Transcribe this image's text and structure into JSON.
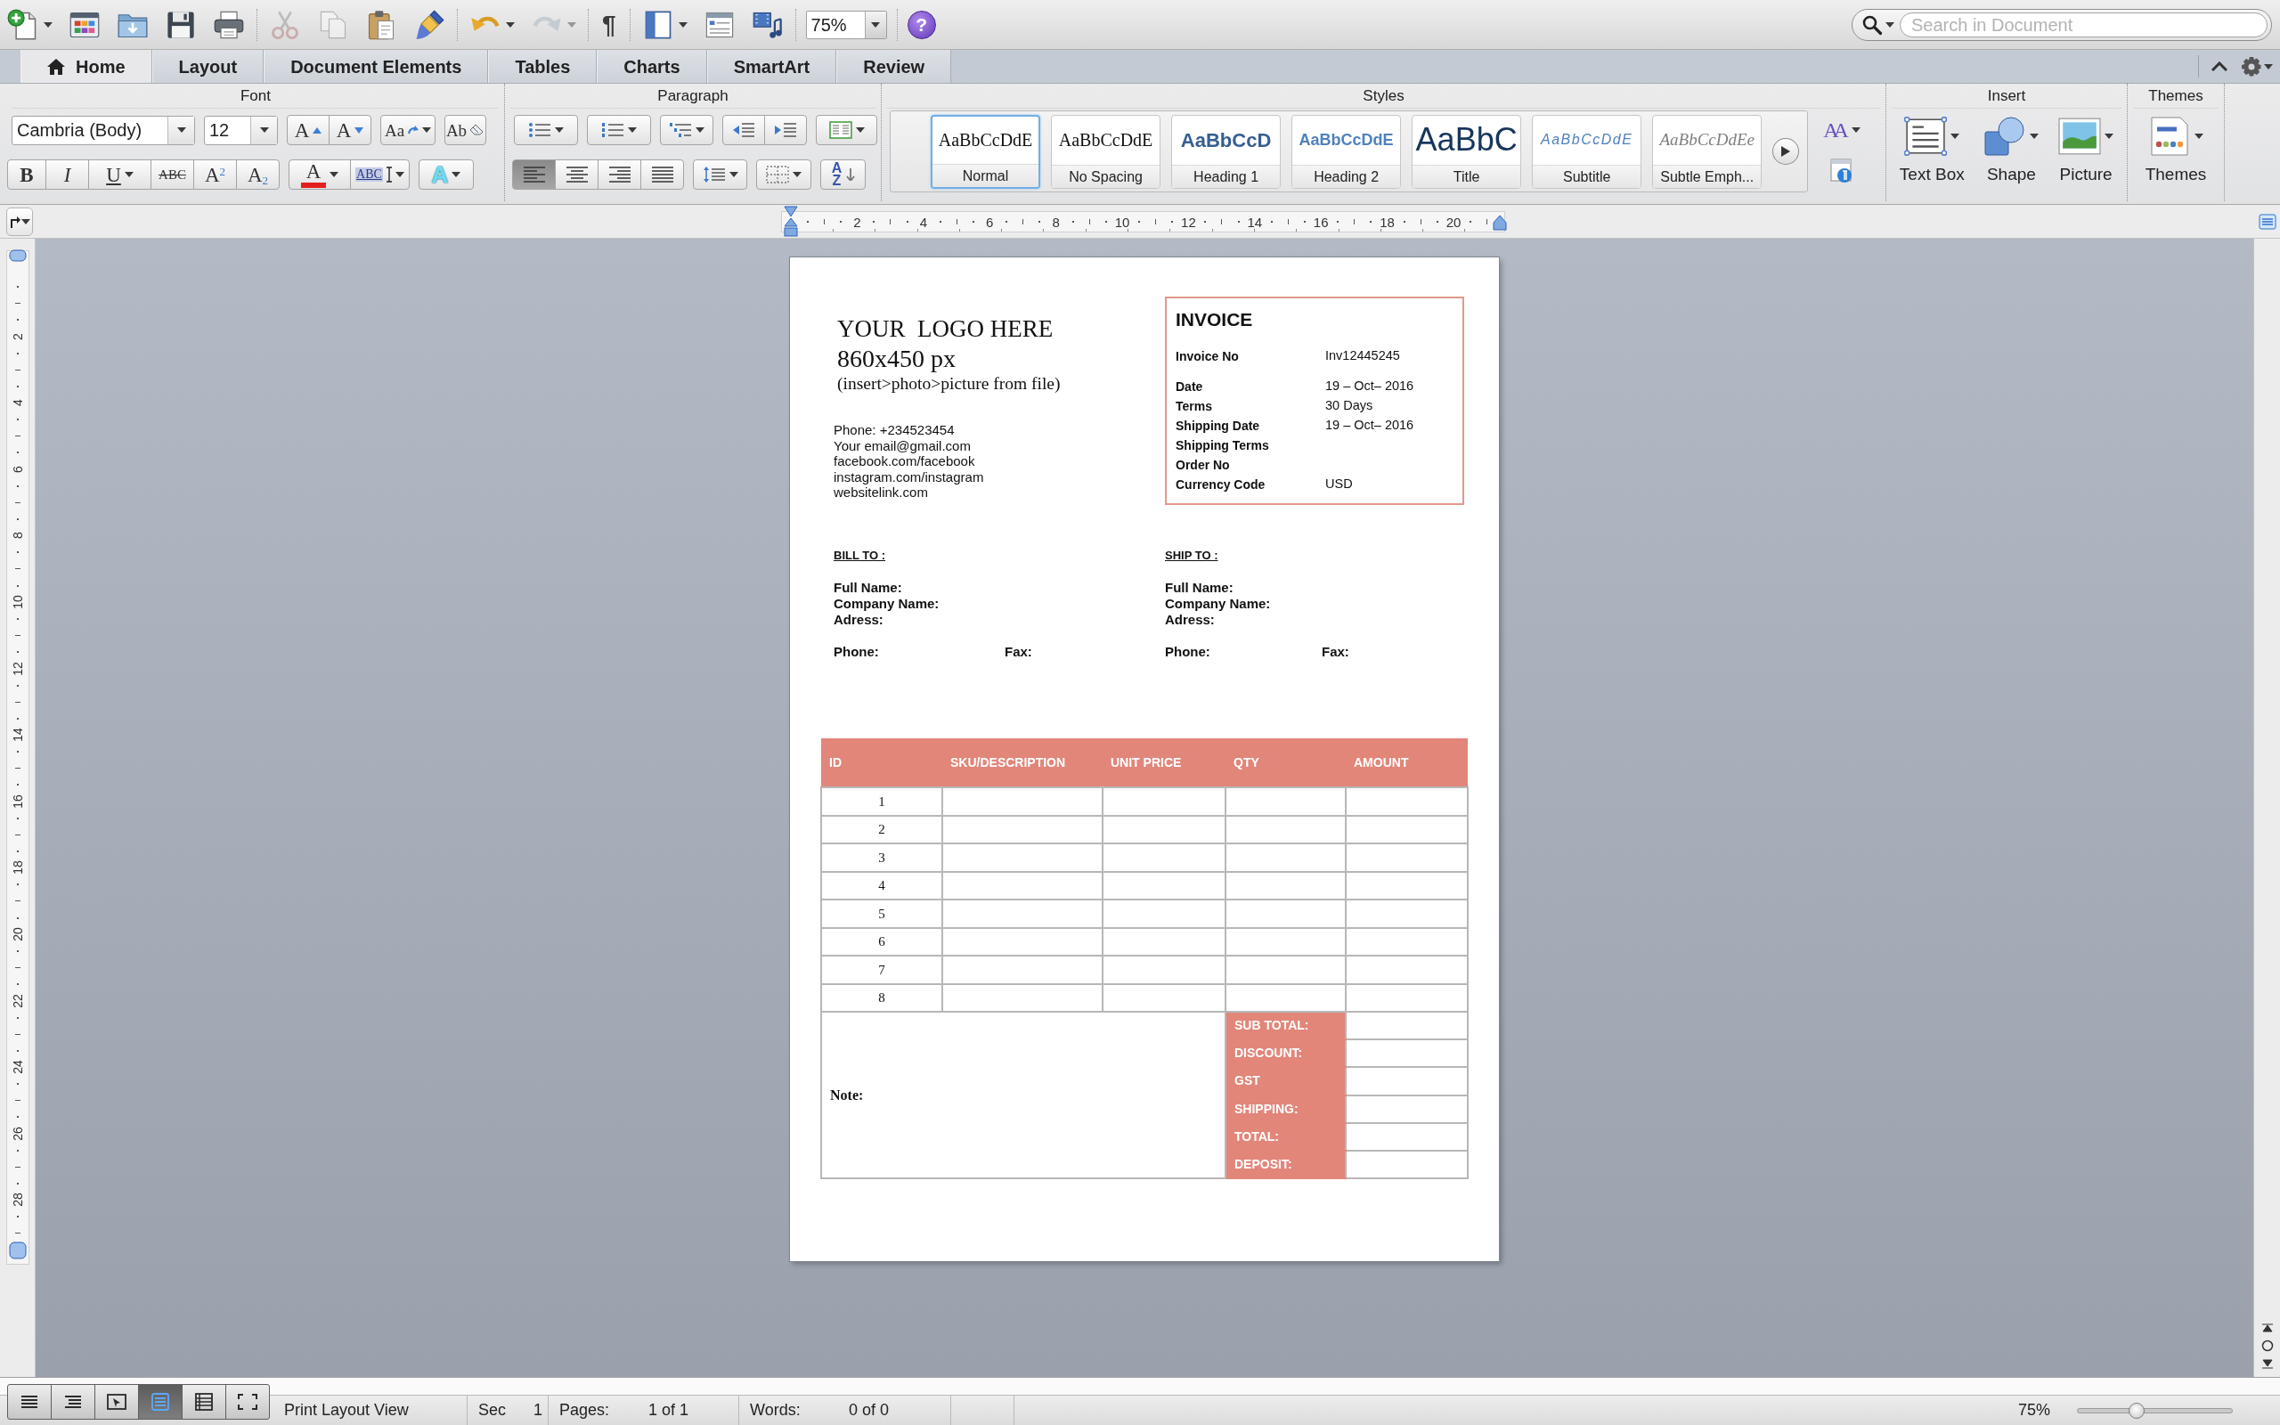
{
  "toolbar": {
    "groups": [
      [
        {
          "kind": "new",
          "menu": true,
          "disabled": false
        },
        {
          "kind": "gallery",
          "menu": false,
          "disabled": false
        },
        {
          "kind": "open",
          "menu": false,
          "disabled": false
        },
        {
          "kind": "save",
          "menu": false,
          "disabled": false
        },
        {
          "kind": "print",
          "menu": false,
          "disabled": false
        }
      ],
      [
        {
          "kind": "cut",
          "menu": false,
          "disabled": true
        },
        {
          "kind": "copy",
          "menu": false,
          "disabled": true
        },
        {
          "kind": "paste",
          "menu": false,
          "disabled": false
        },
        {
          "kind": "painter",
          "menu": false,
          "disabled": false
        }
      ],
      [
        {
          "kind": "undo",
          "menu": true,
          "disabled": false
        },
        {
          "kind": "redo",
          "menu": true,
          "disabled": true
        }
      ],
      [
        {
          "kind": "marks",
          "label": "¶",
          "menu": false,
          "disabled": false
        }
      ],
      [
        {
          "kind": "sidebar",
          "menu": true,
          "disabled": false
        },
        {
          "kind": "toolbox",
          "menu": false,
          "disabled": false
        },
        {
          "kind": "media",
          "menu": false,
          "disabled": false
        }
      ],
      [
        {
          "kind": "zoom",
          "value": "75%",
          "menu": true,
          "disabled": false
        }
      ],
      [
        {
          "kind": "help",
          "label": "?",
          "menu": false,
          "disabled": false
        }
      ]
    ],
    "search": {
      "placeholder": "Search in Document"
    }
  },
  "tabs": [
    {
      "label": "Home",
      "selected": true
    },
    {
      "label": "Layout",
      "selected": false
    },
    {
      "label": "Document Elements",
      "selected": false
    },
    {
      "label": "Tables",
      "selected": false
    },
    {
      "label": "Charts",
      "selected": false
    },
    {
      "label": "SmartArt",
      "selected": false
    },
    {
      "label": "Review",
      "selected": false
    }
  ],
  "ribbon": {
    "groups": [
      {
        "kind": "font",
        "title": "Font",
        "font_name": "Cambria (Body)",
        "font_size": "12",
        "rows": [
          [
            {
              "kind": "grow",
              "label": "A",
              "menu": false
            },
            {
              "kind": "shrink",
              "label": "A",
              "menu": false
            },
            {
              "kind": "case",
              "label": "Aa",
              "menu": true
            },
            {
              "kind": "clear",
              "label": "Ab",
              "menu": false
            }
          ],
          [
            {
              "kind": "bold",
              "label": "B",
              "menu": false
            },
            {
              "kind": "italic",
              "label": "I",
              "menu": false
            },
            {
              "kind": "underline",
              "label": "U",
              "menu": true
            },
            {
              "kind": "strike",
              "label": "ABC",
              "menu": false
            },
            {
              "kind": "superscript",
              "label": "A$^{2}$",
              "menu": false
            },
            {
              "kind": "subscript",
              "label": "A$_{2}$",
              "menu": false
            },
            {
              "kind": "color",
              "label": "A",
              "menu": true
            },
            {
              "kind": "highlight",
              "label": "ABC",
              "menu": true
            },
            {
              "kind": "effects",
              "label": "A",
              "menu": true
            }
          ]
        ]
      },
      {
        "kind": "paragraph",
        "title": "Paragraph",
        "row1": [
          {
            "kind": "bullets",
            "menu": true
          },
          {
            "kind": "numbering",
            "menu": true
          },
          {
            "kind": "multilevel",
            "menu": true
          },
          {
            "kind": "outdent",
            "menu": false
          },
          {
            "kind": "indent",
            "menu": false
          },
          {
            "kind": "columns",
            "menu": true
          }
        ],
        "alignment": [
          {
            "kind": "left",
            "selected": true
          },
          {
            "kind": "center",
            "selected": false
          },
          {
            "kind": "right",
            "selected": false
          },
          {
            "kind": "justify",
            "selected": false
          }
        ],
        "row2": [
          {
            "kind": "spacing",
            "menu": true
          },
          {
            "kind": "borders",
            "menu": true
          },
          {
            "kind": "sort",
            "label": "AZ",
            "menu": false
          }
        ]
      },
      {
        "kind": "styles",
        "title": "Styles",
        "change_label": "AA",
        "items": [
          {
            "kind": "normal",
            "sample": "AaBbCcDdE",
            "label": "Normal",
            "selected": true
          },
          {
            "kind": "normal",
            "sample": "AaBbCcDdE",
            "label": "No Spacing",
            "selected": false
          },
          {
            "kind": "heading1",
            "sample": "AaBbCcD",
            "label": "Heading 1",
            "selected": false
          },
          {
            "kind": "heading2",
            "sample": "AaBbCcDdE",
            "label": "Heading 2",
            "selected": false
          },
          {
            "kind": "title",
            "sample": "AaBbC",
            "label": "Title",
            "selected": false
          },
          {
            "kind": "subtitle",
            "sample": "AaBbCcDdE",
            "label": "Subtitle",
            "selected": false
          },
          {
            "kind": "emphasis",
            "sample": "AaBbCcDdEe",
            "label": "Subtle Emph...",
            "selected": false
          }
        ]
      },
      {
        "kind": "insert",
        "title": "Insert",
        "items": [
          {
            "kind": "textbox",
            "label": "Text Box"
          },
          {
            "kind": "shape",
            "label": "Shape"
          },
          {
            "kind": "picture",
            "label": "Picture"
          }
        ]
      },
      {
        "kind": "themes",
        "title": "Themes",
        "items": [
          {
            "kind": "themes",
            "label": "Themes"
          }
        ]
      }
    ]
  },
  "ruler": {
    "numbers": [
      "2",
      "4",
      "6",
      "8",
      "10",
      "12",
      "14",
      "16",
      "18",
      "20"
    ]
  },
  "vertical_ruler": {
    "numbers": [
      "2",
      "4",
      "6",
      "8",
      "10",
      "12",
      "14",
      "16",
      "18",
      "20",
      "22",
      "24",
      "26",
      "28"
    ]
  },
  "document": {
    "logo": {
      "title": "YOUR  LOGO HERE",
      "size": "860x450 px",
      "hint": "(insert>photo>picture from file)"
    },
    "contact": [
      "Phone: +234523454",
      "Your email@gmail.com",
      "facebook.com/facebook",
      "instagram.com/instagram",
      "websitelink.com"
    ],
    "invoice": {
      "title": "INVOICE",
      "fields": [
        {
          "label": "Invoice No",
          "value": "Inv12445245"
        },
        {
          "label": "Date",
          "value": "19 – Oct– 2016"
        },
        {
          "label": "Terms",
          "value": "30 Days"
        },
        {
          "label": "Shipping Date",
          "value": "19 – Oct– 2016"
        },
        {
          "label": "Shipping Terms"
        },
        {
          "label": "Order No"
        },
        {
          "label": "Currency Code",
          "value": "USD"
        }
      ]
    },
    "parties": [
      {
        "heading": "BILL TO :",
        "fields": [
          "Full Name:",
          "Company Name:",
          "Adress:"
        ],
        "phone": "Phone:",
        "fax": "Fax:"
      },
      {
        "heading": "SHIP TO :",
        "fields": [
          "Full Name:",
          "Company Name:",
          "Adress:"
        ],
        "phone": "Phone:",
        "fax": "Fax:"
      }
    ],
    "items_table": {
      "columns": [
        "ID",
        "SKU/DESCRIPTION",
        "UNIT PRICE",
        "QTY",
        "AMOUNT"
      ],
      "rows": [
        {
          "id": "1"
        },
        {
          "id": "2"
        },
        {
          "id": "3"
        },
        {
          "id": "4"
        },
        {
          "id": "5"
        },
        {
          "id": "6"
        },
        {
          "id": "7"
        },
        {
          "id": "8"
        }
      ],
      "note": "Note:",
      "totals": [
        "SUB TOTAL:",
        "DISCOUNT:",
        "GST",
        "SHIPPING:",
        "TOTAL:",
        "DEPOSIT:"
      ]
    }
  },
  "status_bar": {
    "views": [
      {
        "kind": "draft",
        "selected": false
      },
      {
        "kind": "outline",
        "selected": false
      },
      {
        "kind": "publishing",
        "selected": false
      },
      {
        "kind": "print",
        "selected": true
      },
      {
        "kind": "notebook",
        "selected": false
      },
      {
        "kind": "focus",
        "selected": false
      }
    ],
    "view_name": "Print Layout View",
    "fields": [
      {
        "label": "Sec",
        "value": "1"
      },
      {
        "label": "Pages:",
        "value": "1 of 1"
      },
      {
        "label": "Words:",
        "value": "0 of 0"
      }
    ],
    "zoom": {
      "value": "75%",
      "level": 0.38
    }
  }
}
